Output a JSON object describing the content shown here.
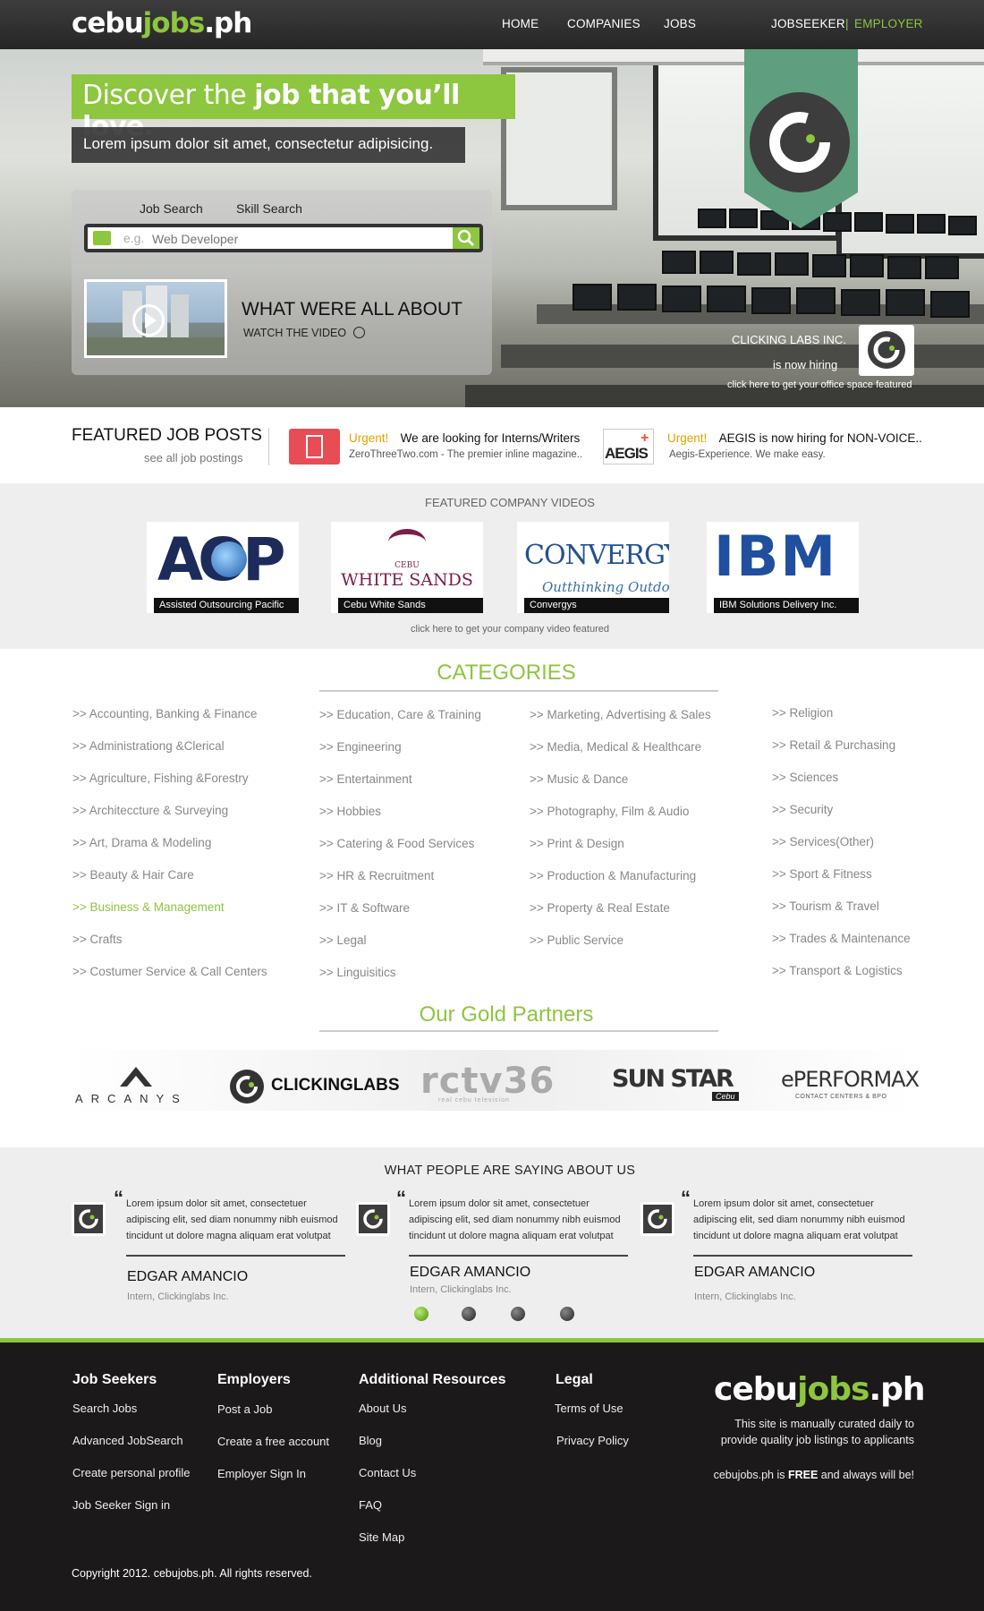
{
  "brand": {
    "logo_part1": "cebu",
    "logo_part2": "jobs",
    "logo_part3": ".ph"
  },
  "colors": {
    "accent": "#8dc63f",
    "urgent": "#e7a100",
    "footer_bg": "#1b1919"
  },
  "nav": {
    "home": "HOME",
    "companies": "COMPANIES",
    "jobs": "JOBS",
    "jobseeker": "JOBSEEKER",
    "separator": "|",
    "employer": "EMPLOYER"
  },
  "hero": {
    "tagline_normal": "Discover the ",
    "tagline_bold": "job that you’ll love.",
    "subtag": "Lorem ipsum dolor sit amet, consectetur adipisicing.",
    "search": {
      "tab_job": "Job Search",
      "tab_skill": "Skill Search",
      "eg_label": "e.g.",
      "placeholder": "Web Developer"
    },
    "video": {
      "title": "WHAT WERE ALL ABOUT",
      "link": "WATCH THE VIDEO"
    },
    "hiring": {
      "company": "CLICKING LABS INC.",
      "status": "is now hiring",
      "featured_link": "click here to get your office space featured"
    }
  },
  "featured_jobs": {
    "title": "FEATURED JOB POSTS",
    "see_all": "see all job postings",
    "posts": [
      {
        "urgent": "Urgent!",
        "title": "We are looking for Interns/Writers",
        "sub": "ZeroThreeTwo.com - The premier inline magazine.."
      },
      {
        "urgent": "Urgent!",
        "title": "AEGIS is now hiring for NON-VOICE..",
        "sub": "Aegis-Experience. We make easy."
      }
    ],
    "aegis_logo": "AEGIS"
  },
  "company_videos": {
    "title": "FEATURED COMPANY VIDEOS",
    "items": [
      {
        "logo": "AOP",
        "caption": "Assisted Outsourcing Pacific"
      },
      {
        "logo_top": "CEBU",
        "logo": "WHITE SANDS",
        "caption": "Cebu White Sands"
      },
      {
        "logo": "CONVERGYS",
        "tag": "Outthinking Outdoing",
        "caption": "Convergys"
      },
      {
        "logo": "IBM",
        "caption": "IBM Solutions Delivery Inc."
      }
    ],
    "featured_link": "click here to get your company video featured"
  },
  "categories": {
    "title": "CATEGORIES",
    "col1": [
      ">> Accounting, Banking & Finance",
      ">> Administrationg &Clerical",
      ">> Agriculture, Fishing &Forestry",
      ">> Architeccture & Surveying",
      ">> Art, Drama & Modeling",
      ">> Beauty & Hair Care",
      ">> Business & Management",
      ">> Crafts",
      ">> Costumer Service & Call Centers"
    ],
    "col2": [
      ">> Education, Care & Training",
      ">> Engineering",
      ">> Entertainment",
      ">> Hobbies",
      ">> Catering & Food Services",
      ">> HR & Recruitment",
      ">> IT & Software",
      ">> Legal",
      ">> Linguisitics"
    ],
    "col3": [
      ">> Marketing, Advertising & Sales",
      ">> Media, Medical & Healthcare",
      ">> Music & Dance",
      ">> Photography, Film & Audio",
      ">> Print & Design",
      ">> Production & Manufacturing",
      ">> Property & Real Estate",
      ">> Public Service"
    ],
    "col4": [
      ">> Religion",
      ">> Retail & Purchasing",
      ">> Sciences",
      ">> Security",
      ">> Services(Other)",
      ">> Sport & Fitness",
      ">> Tourism & Travel",
      ">> Trades & Maintenance",
      ">> Transport & Logistics"
    ]
  },
  "partners": {
    "title": "Our Gold Partners",
    "arcanys": "ARCANYS",
    "clickinglabs": "CLICKINGLABS",
    "rctv": "rctv36",
    "rctv_sub": "real cebu television",
    "sunstar": "SUN STAR",
    "sunstar_sub": "Cebu",
    "eperformax": "ePERFORMAX",
    "eperformax_sub": "CONTACT CENTERS & BPO"
  },
  "testimonials": {
    "title": "WHAT PEOPLE ARE SAYING ABOUT US",
    "items": [
      {
        "quote": "Lorem ipsum dolor sit amet, consectetuer adipiscing elit, sed diam nonummy nibh euismod tincidunt ut dolore magna aliquam erat volutpat",
        "name": "EDGAR AMANCIO",
        "role": "Intern, Clickinglabs Inc."
      },
      {
        "quote": "Lorem ipsum dolor sit amet, consectetuer adipiscing elit, sed diam nonummy nibh euismod tincidunt ut dolore magna aliquam erat volutpat",
        "name": "EDGAR AMANCIO",
        "role": "Intern, Clickinglabs Inc."
      },
      {
        "quote": "Lorem ipsum dolor sit amet, consectetuer adipiscing elit, sed diam nonummy nibh euismod tincidunt ut dolore magna aliquam erat volutpat",
        "name": "EDGAR AMANCIO",
        "role": "Intern, Clickinglabs Inc."
      }
    ],
    "active_dot": 0
  },
  "footer": {
    "job_seekers": {
      "title": "Job Seekers",
      "links": [
        "Search Jobs",
        "Advanced JobSearch",
        "Create personal profile",
        "Job Seeker Sign in"
      ]
    },
    "employers": {
      "title": "Employers",
      "links": [
        "Post a Job",
        "Create a free account",
        "Employer Sign In"
      ]
    },
    "resources": {
      "title": "Additional Resources",
      "links": [
        "About Us",
        "Blog",
        "Contact Us",
        "FAQ",
        "Site Map"
      ]
    },
    "legal": {
      "title": "Legal",
      "links": [
        "Terms of Use",
        "Privacy Policy"
      ]
    },
    "description": "This site is manually curated daily to provide quality job listings to applicants",
    "free_prefix": "cebujobs.ph is ",
    "free_bold": "FREE",
    "free_suffix": " and always will be!",
    "copyright": "Copyright 2012. cebujobs.ph. All rights reserved."
  }
}
